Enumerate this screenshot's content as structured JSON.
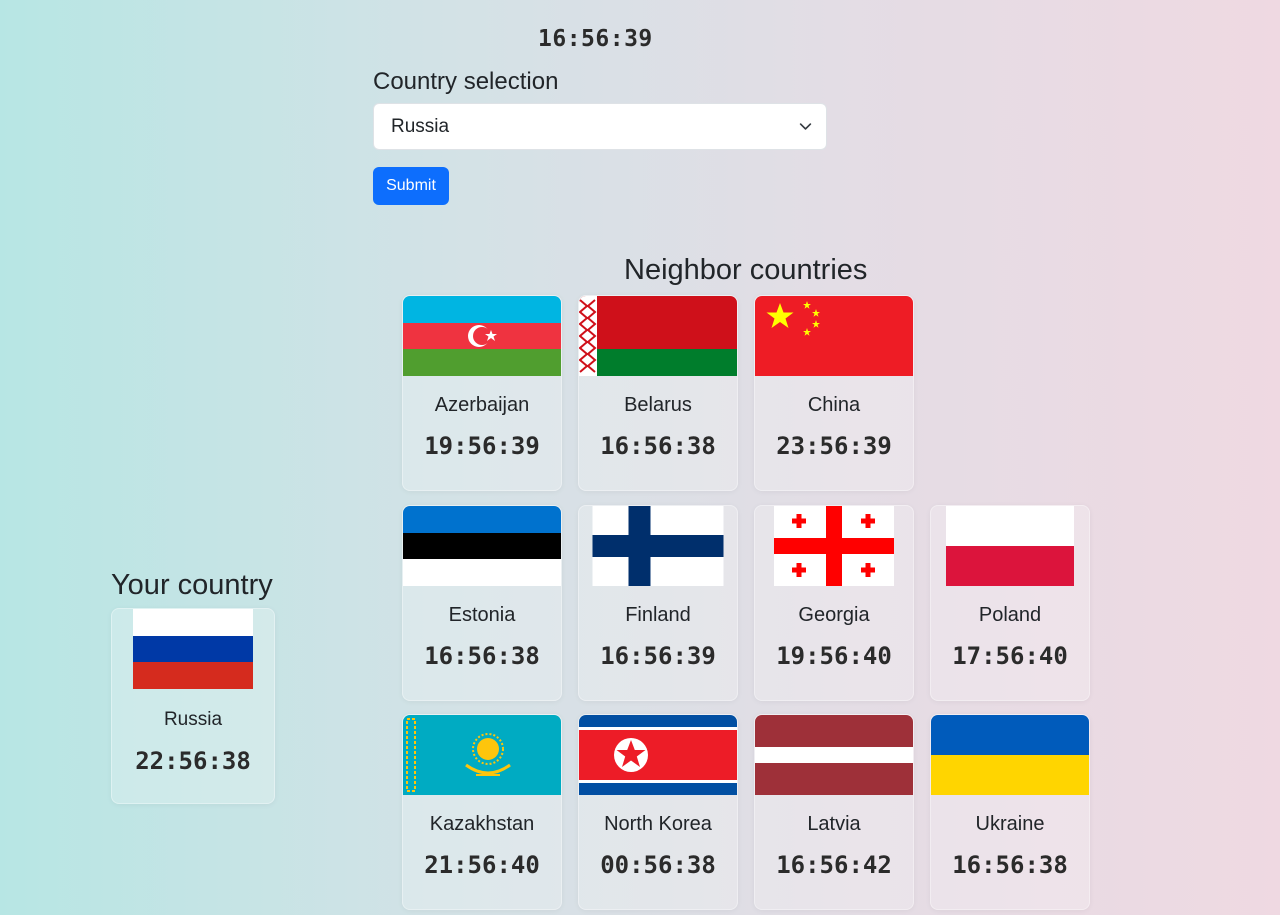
{
  "clock": "16:56:39",
  "selection": {
    "label": "Country selection",
    "value": "Russia",
    "submit_label": "Submit"
  },
  "neighbors": {
    "title": "Neighbor countries",
    "countries": [
      {
        "name": "Azerbaijan",
        "time": "19:56:39",
        "flag": "azerbaijan-flag-icon"
      },
      {
        "name": "Belarus",
        "time": "16:56:38",
        "flag": "belarus-flag-icon"
      },
      {
        "name": "China",
        "time": "23:56:39",
        "flag": "china-flag-icon"
      },
      {
        "name": "Estonia",
        "time": "16:56:38",
        "flag": "estonia-flag-icon"
      },
      {
        "name": "Finland",
        "time": "16:56:39",
        "flag": "finland-flag-icon"
      },
      {
        "name": "Georgia",
        "time": "19:56:40",
        "flag": "georgia-flag-icon"
      },
      {
        "name": "Poland",
        "time": "17:56:40",
        "flag": "poland-flag-icon"
      },
      {
        "name": "Kazakhstan",
        "time": "21:56:40",
        "flag": "kazakhstan-flag-icon"
      },
      {
        "name": "North Korea",
        "time": "00:56:38",
        "flag": "north-korea-flag-icon"
      },
      {
        "name": "Latvia",
        "time": "16:56:42",
        "flag": "latvia-flag-icon"
      },
      {
        "name": "Ukraine",
        "time": "16:56:38",
        "flag": "ukraine-flag-icon"
      }
    ]
  },
  "your_country": {
    "title": "Your country",
    "name": "Russia",
    "time": "22:56:38",
    "flag": "russia-flag-icon"
  },
  "colors": {
    "accent": "#0d6efd",
    "background_left": "#b7e6e4",
    "background_right": "#efd9e2"
  }
}
